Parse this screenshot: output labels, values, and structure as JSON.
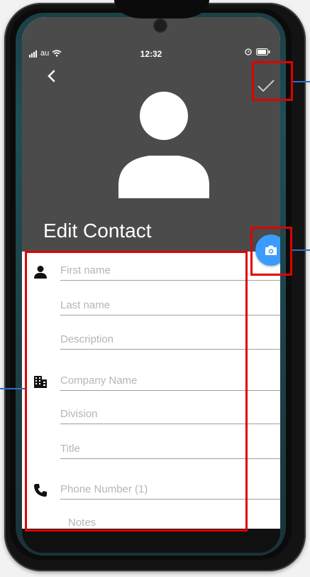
{
  "status": {
    "carrier": "au",
    "time": "12:32"
  },
  "header": {
    "title": "Edit Contact"
  },
  "form": {
    "first_name": "First name",
    "last_name": "Last name",
    "description": "Description",
    "company": "Company Name",
    "division": "Division",
    "job_title": "Title",
    "phone": "Phone Number (1)",
    "notes": "Notes"
  },
  "icons": {
    "back": "chevron-left-icon",
    "save": "check-icon",
    "camera": "camera-icon",
    "person": "person-icon",
    "company": "building-icon",
    "phone": "phone-icon"
  },
  "colors": {
    "header_bg": "#4b4b4b",
    "camera_button": "#3b9cff",
    "highlight_box": "#e00000",
    "callout_line": "#2d6dc4"
  }
}
